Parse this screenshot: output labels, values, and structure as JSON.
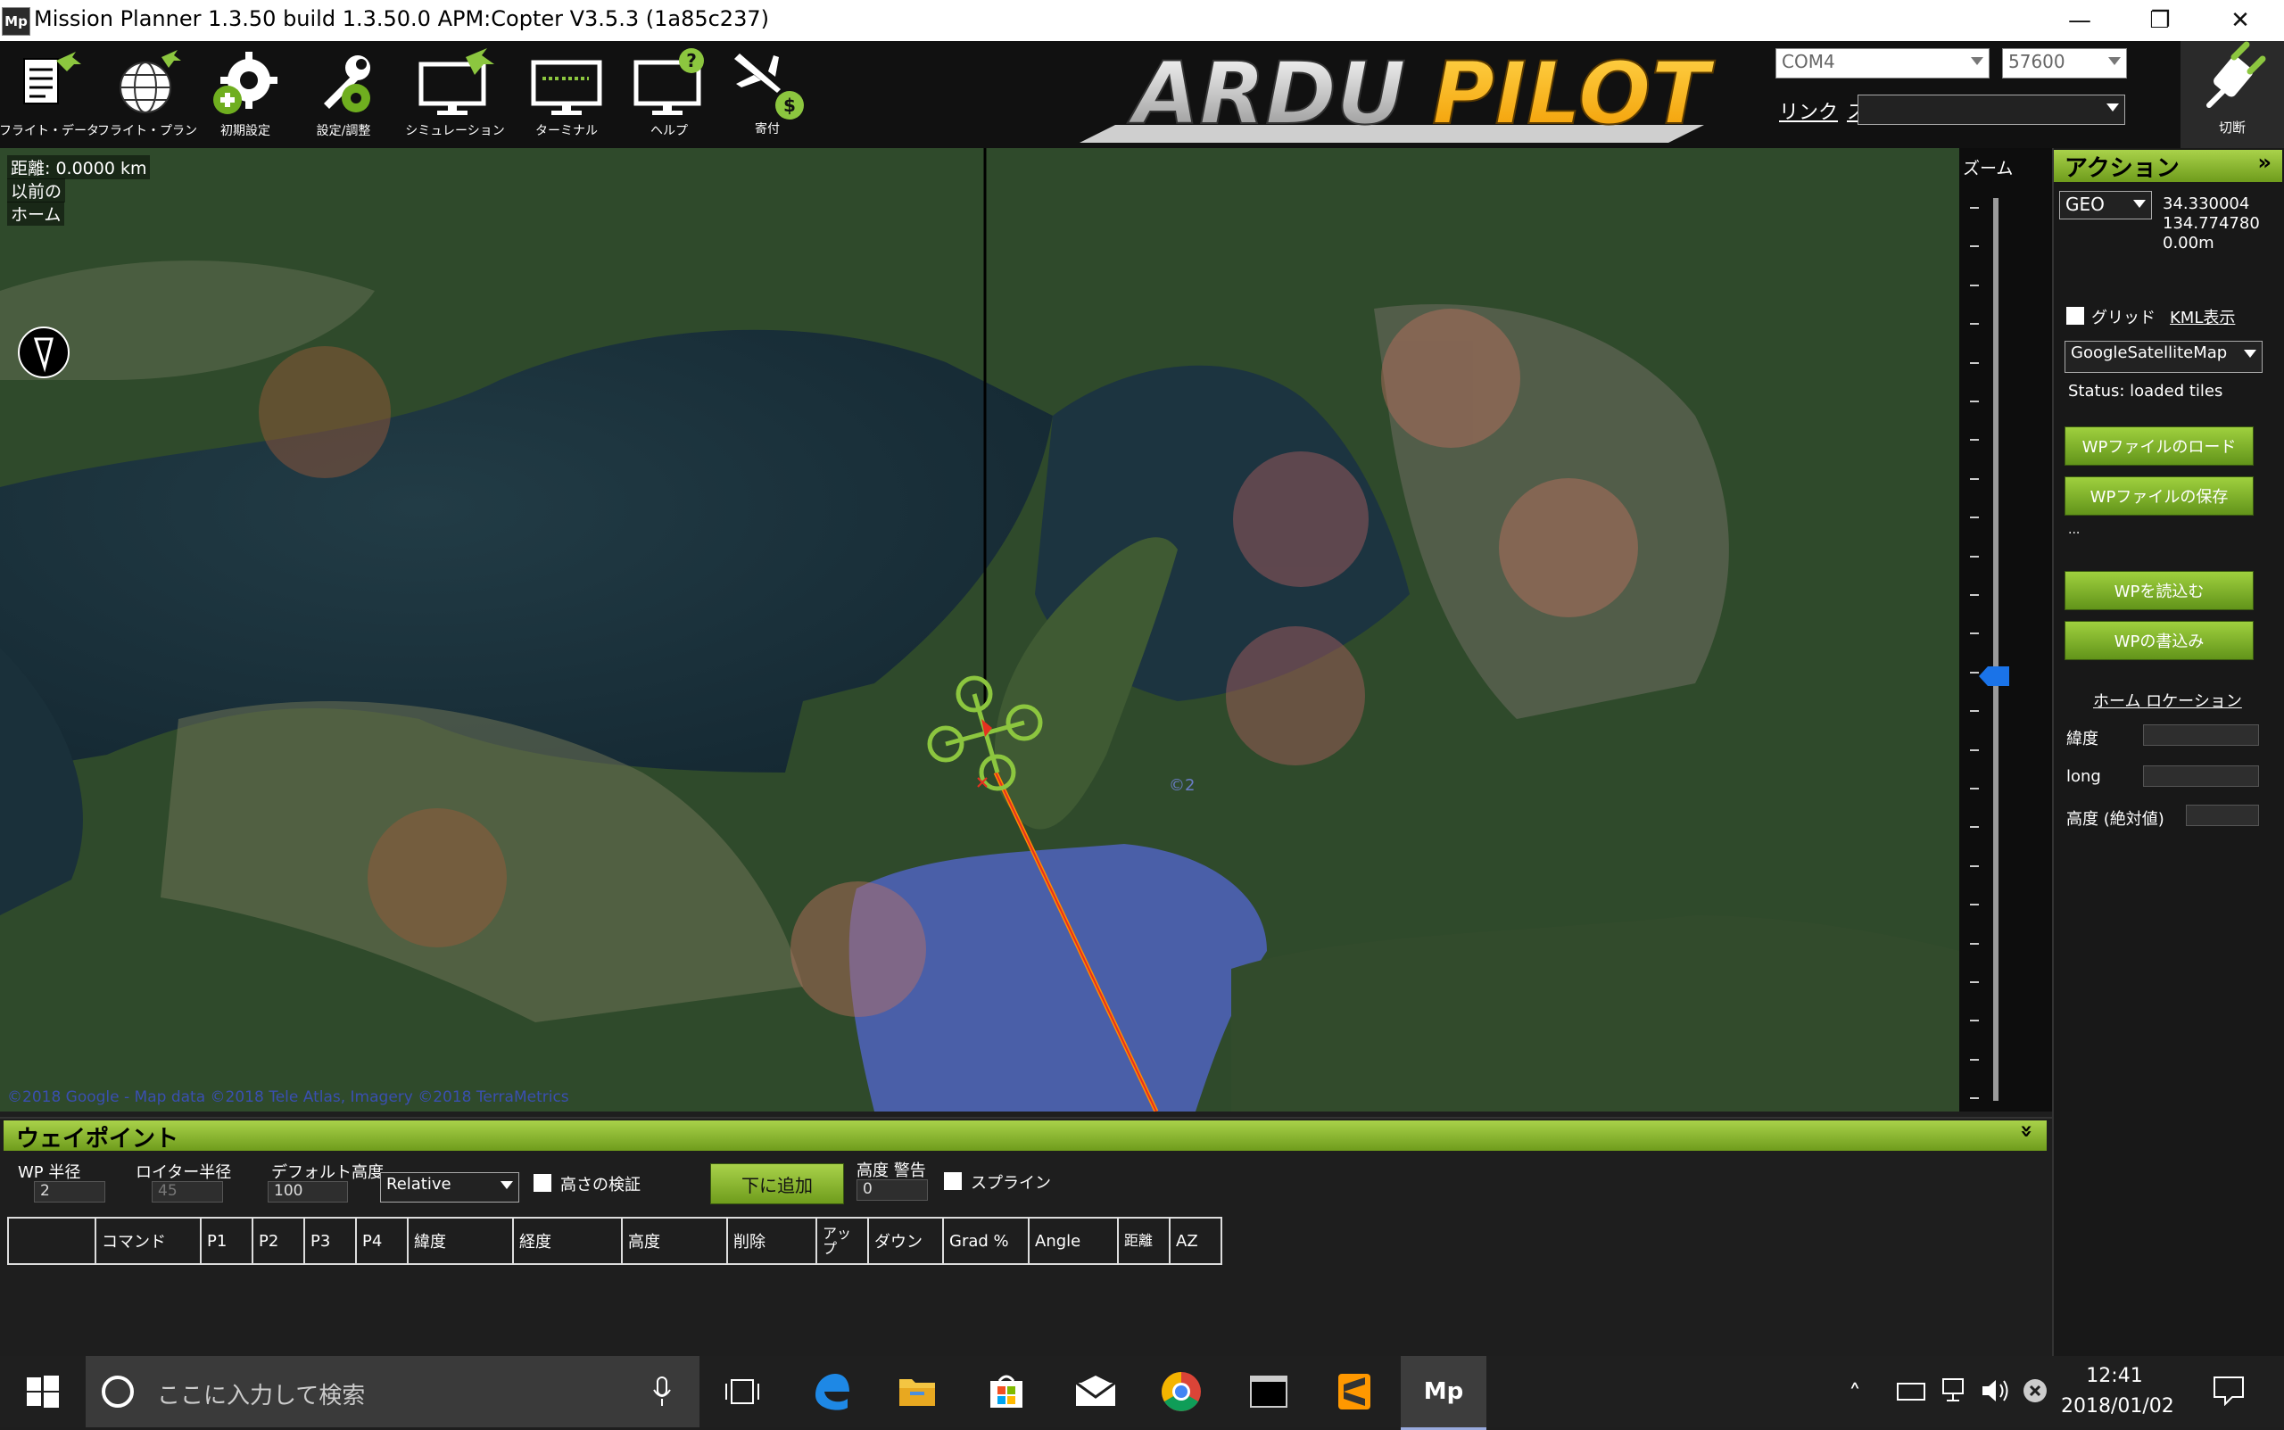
{
  "window": {
    "title": "Mission Planner 1.3.50 build 1.3.50.0 APM:Copter V3.5.3 (1a85c237)",
    "app_icon": "Mp",
    "minimize": "—",
    "restore": "❐",
    "close": "✕"
  },
  "toolbar": {
    "buttons": [
      {
        "label": "フライト・データ",
        "icon": "flight-data-icon"
      },
      {
        "label": "フライト・プラン",
        "icon": "flight-plan-icon"
      },
      {
        "label": "初期設定",
        "icon": "initial-setup-icon"
      },
      {
        "label": "設定/調整",
        "icon": "config-tuning-icon"
      },
      {
        "label": "シミュレーション",
        "icon": "simulation-icon"
      },
      {
        "label": "ターミナル",
        "icon": "terminal-icon"
      },
      {
        "label": "ヘルプ",
        "icon": "help-icon"
      },
      {
        "label": "寄付",
        "icon": "donate-icon"
      }
    ],
    "logo_text": "ARDUPILOT",
    "port": "COM4",
    "baud": "57600",
    "link_label": "リンク",
    "link_stats_label": "ス",
    "disconnect_label": "切断",
    "accent": "#8cc63f"
  },
  "map": {
    "distance": "距離: 0.0000 km",
    "previous_label": "以前の",
    "home_label": "ホーム",
    "copyright": "©2018 Google - Map data ©2018 Tele Atlas, Imagery ©2018 TerraMetrics",
    "watermark": "©2"
  },
  "zoom": {
    "label": "ズーム",
    "level": 0.53
  },
  "action_panel": {
    "header": "アクション",
    "collapse_glyph": "»",
    "coord_mode": "GEO",
    "lat": "34.330004",
    "lon": "134.774780",
    "alt": "0.00m",
    "grid_label": "グリッド",
    "kml_label": "KML表示",
    "map_type": "GoogleSatelliteMap",
    "status": "Status: loaded tiles",
    "load_wp_file": "WPファイルのロード",
    "save_wp_file": "WPファイルの保存",
    "ellipsis": "...",
    "read_wp": "WPを読込む",
    "write_wp": "WPの書込み",
    "home_location": "ホーム ロケーション",
    "home_lat_label": "緯度",
    "home_lon_label": "long",
    "home_alt_label": "高度 (絶対値)"
  },
  "waypoints": {
    "header": "ウェイポイント",
    "collapse_glyph": "»",
    "wp_radius_label": "WP 半径",
    "wp_radius": "2",
    "loiter_radius_label": "ロイター半径",
    "loiter_radius": "45",
    "default_alt_label": "デフォルト高度",
    "default_alt": "100",
    "alt_mode": "Relative",
    "verify_height_label": "高さの検証",
    "add_below_label": "下に追加",
    "alt_warning_label": "高度 警告",
    "alt_warning": "0",
    "spline_label": "スプライン",
    "columns": [
      "",
      "コマンド",
      "P1",
      "P2",
      "P3",
      "P4",
      "緯度",
      "経度",
      "高度",
      "削除",
      "アップ",
      "ダウン",
      "Grad %",
      "Angle",
      "距離",
      "AZ"
    ]
  },
  "taskbar": {
    "search_placeholder": "ここに入力して検索",
    "time": "12:41",
    "date": "2018/01/02",
    "apps": [
      "task-view-icon",
      "edge-icon",
      "file-explorer-icon",
      "store-icon",
      "mail-icon",
      "chrome-icon",
      "terminal-app-icon",
      "sublime-icon",
      "mission-planner-icon"
    ],
    "mission_planner_icon_text": "Mp"
  }
}
